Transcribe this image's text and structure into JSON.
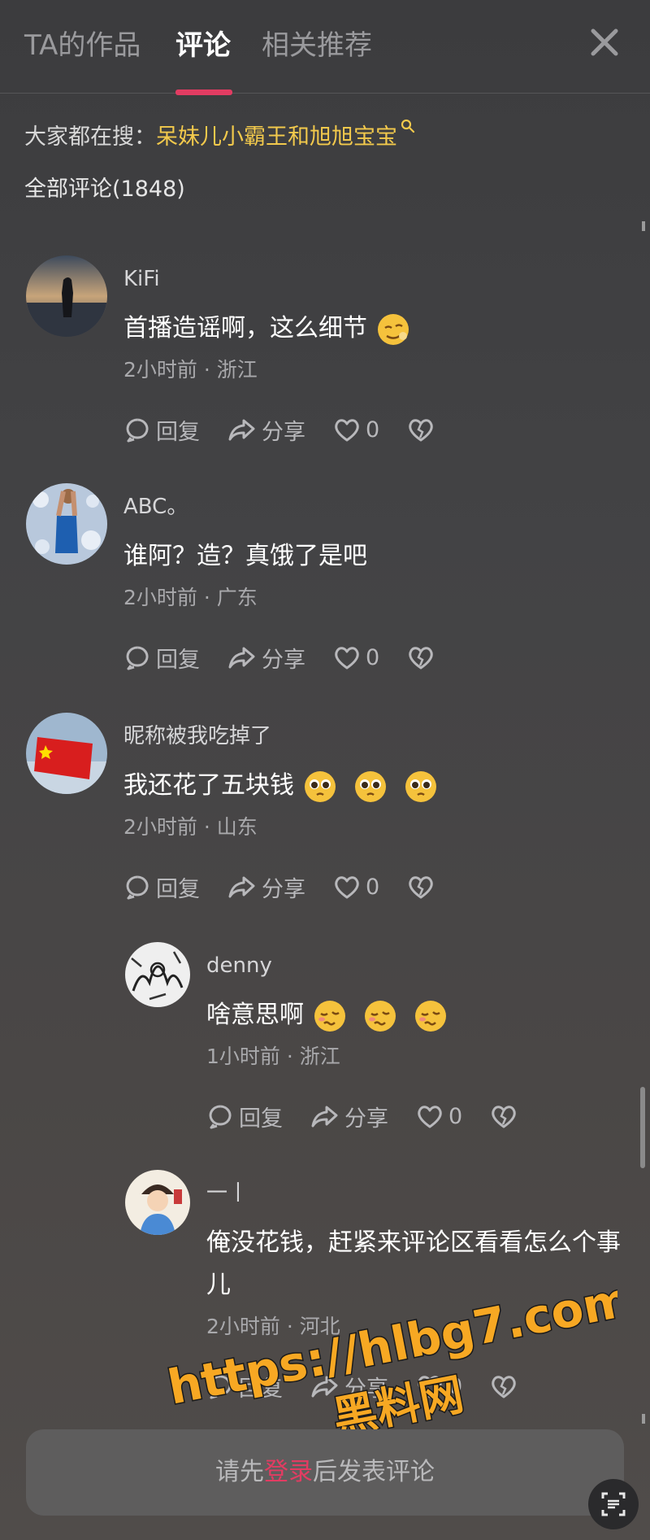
{
  "tabs": [
    {
      "label": "TA的作品"
    },
    {
      "label": "评论"
    },
    {
      "label": "相关推荐"
    }
  ],
  "hot_search": {
    "prefix": "大家都在搜：",
    "term": "呆妹儿小霸王和旭旭宝宝"
  },
  "comment_count": "全部评论(1848)",
  "actions": {
    "reply": "回复",
    "share": "分享"
  },
  "comments": [
    {
      "user": "KiFi",
      "text": "首播造谣啊，这么细节",
      "time": "2小时前",
      "location": "浙江",
      "likes": "0",
      "emoji_count": 1,
      "emoji": "smirk-face"
    },
    {
      "user": "ABC。",
      "text": "谁阿？造？真饿了是吧",
      "time": "2小时前",
      "location": "广东",
      "likes": "0",
      "emoji_count": 0
    },
    {
      "user": "昵称被我吃掉了",
      "text": "我还花了五块钱",
      "time": "2小时前",
      "location": "山东",
      "likes": "0",
      "emoji_count": 3,
      "emoji": "pleading-face"
    }
  ],
  "replies": [
    {
      "user": "denny",
      "text": "啥意思啊",
      "time": "1小时前",
      "location": "浙江",
      "likes": "0",
      "emoji_count": 3,
      "emoji": "woozy-face"
    },
    {
      "user": "一丨",
      "text": "俺没花钱，赶紧来评论区看看怎么个事儿",
      "time": "2小时前",
      "location": "河北",
      "likes": "0"
    }
  ],
  "separator": "·",
  "input": {
    "prefix": "请先",
    "link": "登录",
    "suffix": "后发表评论"
  },
  "watermark": {
    "line1": "https://hlbg7.com",
    "line2": "黑料网"
  },
  "colors": {
    "accent": "#e23c62",
    "hot_term": "#f2c94c",
    "watermark_fill": "#f7a823"
  }
}
